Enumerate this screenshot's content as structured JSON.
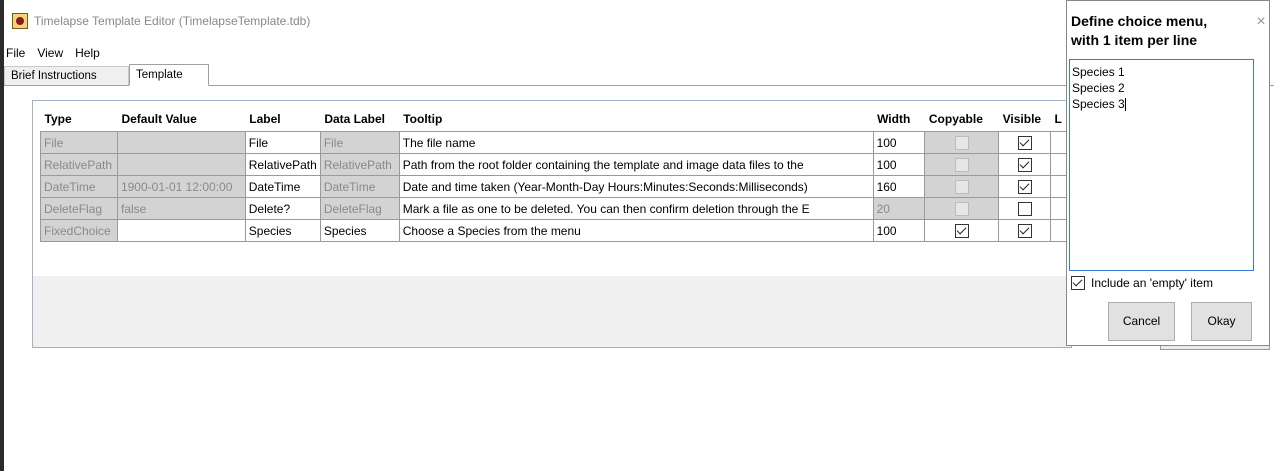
{
  "window": {
    "title": "Timelapse Template Editor (TimelapseTemplate.tdb)"
  },
  "menu": [
    "File",
    "View",
    "Help"
  ],
  "tabs": [
    {
      "label": "Brief Instructions",
      "active": false
    },
    {
      "label": "Template",
      "active": true
    }
  ],
  "grid": {
    "columns": [
      "Type",
      "Default Value",
      "Label",
      "Data Label",
      "Tooltip",
      "Width",
      "Copyable",
      "Visible",
      "L"
    ],
    "rows": [
      {
        "type": "File",
        "default_value": "",
        "label": "File",
        "data_label": "File",
        "tooltip": "The file name",
        "width": "100",
        "copyable": false,
        "copyable_enabled": false,
        "visible": true,
        "visible_enabled": true
      },
      {
        "type": "RelativePath",
        "default_value": "",
        "label": "RelativePath",
        "data_label": "RelativePath",
        "tooltip": "Path from the root folder containing the template and image data files to the",
        "width": "100",
        "copyable": false,
        "copyable_enabled": false,
        "visible": true,
        "visible_enabled": true
      },
      {
        "type": "DateTime",
        "default_value": "1900-01-01 12:00:00",
        "label": "DateTime",
        "data_label": "DateTime",
        "tooltip": "Date and time taken (Year-Month-Day Hours:Minutes:Seconds:Milliseconds)",
        "width": "160",
        "copyable": false,
        "copyable_enabled": false,
        "visible": true,
        "visible_enabled": true
      },
      {
        "type": "DeleteFlag",
        "default_value": "false",
        "label": "Delete?",
        "data_label": "DeleteFlag",
        "tooltip": "Mark a file as one to be deleted. You can then confirm deletion through the E",
        "width": "20",
        "copyable": false,
        "copyable_enabled": false,
        "visible": false,
        "visible_enabled": true
      },
      {
        "type": "FixedChoice",
        "default_value": "",
        "label": "Species",
        "data_label": "Species",
        "tooltip": "Choose a Species from the menu",
        "width": "100",
        "copyable": true,
        "copyable_enabled": true,
        "visible": true,
        "visible_enabled": true
      }
    ]
  },
  "choice_popup": {
    "title": "Define choice menu, with 1 item per line",
    "items": [
      "Species 1",
      "Species 2",
      "Species 3"
    ],
    "include_empty_label": "Include an 'empty' item",
    "include_empty_checked": true,
    "cancel_label": "Cancel",
    "okay_label": "Okay",
    "close_glyph": "×"
  }
}
